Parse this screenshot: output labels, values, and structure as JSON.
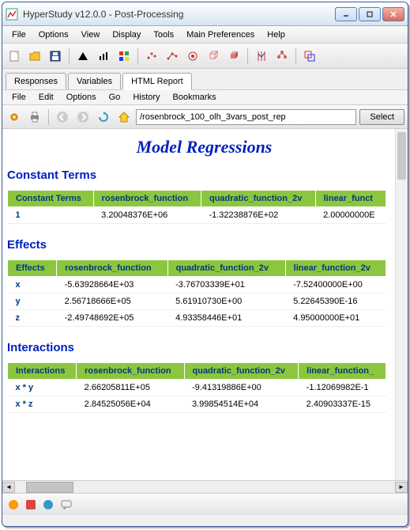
{
  "window": {
    "title": "HyperStudy v12.0.0 - Post-Processing"
  },
  "menu": {
    "file": "File",
    "options": "Options",
    "view": "View",
    "display": "Display",
    "tools": "Tools",
    "mainprefs": "Main Preferences",
    "help": "Help"
  },
  "tabs": {
    "responses": "Responses",
    "variables": "Variables",
    "htmlreport": "HTML Report"
  },
  "submenu": {
    "file": "File",
    "edit": "Edit",
    "options": "Options",
    "go": "Go",
    "history": "History",
    "bookmarks": "Bookmarks"
  },
  "nav": {
    "url": "/rosenbrock_100_olh_3vars_post_rep",
    "select": "Select"
  },
  "report": {
    "title": "Model Regressions",
    "sections": {
      "constant": {
        "heading": "Constant Terms",
        "headers": [
          "Constant Terms",
          "rosenbrock_function",
          "quadratic_function_2v",
          "linear_funct"
        ],
        "rows": [
          {
            "label": "1",
            "c0": "3.20048376E+06",
            "c1": "-1.32238876E+02",
            "c2": "2.00000000E"
          }
        ]
      },
      "effects": {
        "heading": "Effects",
        "headers": [
          "Effects",
          "rosenbrock_function",
          "quadratic_function_2v",
          "linear_function_2v"
        ],
        "rows": [
          {
            "label": "x",
            "c0": "-5.63928664E+03",
            "c1": "-3.76703339E+01",
            "c2": "-7.52400000E+00"
          },
          {
            "label": "y",
            "c0": "2.56718666E+05",
            "c1": "5.61910730E+00",
            "c2": "5.22645390E-16"
          },
          {
            "label": "z",
            "c0": "-2.49748692E+05",
            "c1": "4.93358446E+01",
            "c2": "4.95000000E+01"
          }
        ]
      },
      "interactions": {
        "heading": "Interactions",
        "headers": [
          "Interactions",
          "rosenbrock_function",
          "quadratic_function_2v",
          "linear_function_"
        ],
        "rows": [
          {
            "label": "x * y",
            "c0": "2.66205811E+05",
            "c1": "-9.41319886E+00",
            "c2": "-1.12069982E-1"
          },
          {
            "label": "x * z",
            "c0": "2.84525056E+04",
            "c1": "3.99854514E+04",
            "c2": "2.40903337E-15"
          }
        ]
      }
    }
  },
  "chart_data": [
    {
      "type": "table",
      "title": "Constant Terms",
      "columns": [
        "Constant Terms",
        "rosenbrock_function",
        "quadratic_function_2v",
        "linear_function"
      ],
      "rows": [
        [
          "1",
          3200483.76,
          -132.238876,
          2.0
        ]
      ]
    },
    {
      "type": "table",
      "title": "Effects",
      "columns": [
        "Effects",
        "rosenbrock_function",
        "quadratic_function_2v",
        "linear_function_2v"
      ],
      "rows": [
        [
          "x",
          -5639.28664,
          -37.6703339,
          -7.524
        ],
        [
          "y",
          256718.666,
          5.6191073,
          5.2264539e-16
        ],
        [
          "z",
          -249748.692,
          49.3358446,
          49.5
        ]
      ]
    },
    {
      "type": "table",
      "title": "Interactions",
      "columns": [
        "Interactions",
        "rosenbrock_function",
        "quadratic_function_2v",
        "linear_function"
      ],
      "rows": [
        [
          "x * y",
          266205.811,
          -9.41319886,
          -0.112069982
        ],
        [
          "x * z",
          28452.5056,
          39985.4514,
          2.40903337e-15
        ]
      ]
    }
  ]
}
